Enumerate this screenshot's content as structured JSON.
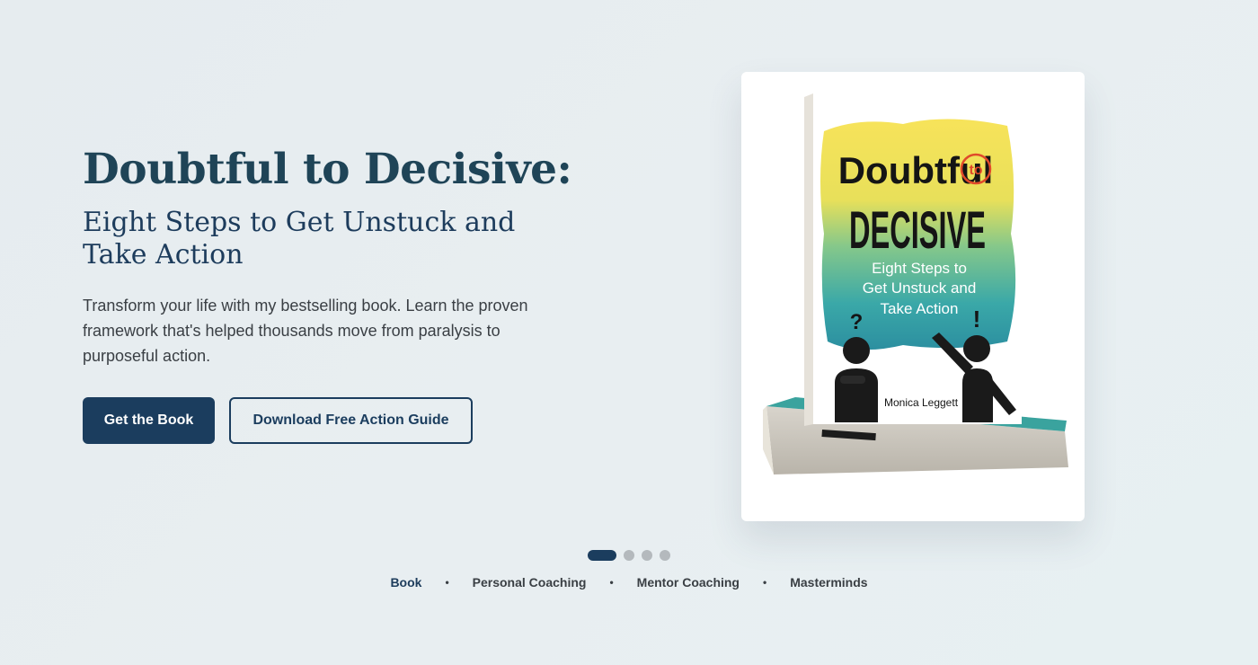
{
  "hero": {
    "title": "Doubtful to Decisive:",
    "subtitle": "Eight Steps to Get Unstuck and Take Action",
    "description": "Transform your life with my bestselling book. Learn the proven framework that's helped thousands move from paralysis to purposeful action.",
    "primary_button": "Get the Book",
    "secondary_button": "Download Free Action Guide"
  },
  "book_cover": {
    "title_line1": "Doubtful",
    "title_to": "to",
    "title_line2": "DECISIVE",
    "subtitle_line1": "Eight Steps to",
    "subtitle_line2": "Get Unstuck and",
    "subtitle_line3": "Take Action",
    "author": "Monica Leggett",
    "question_mark": "?",
    "exclamation_mark": "!"
  },
  "carousel": {
    "slide_count": 4,
    "active_index": 0
  },
  "slide_nav": {
    "items": [
      "Book",
      "Personal Coaching",
      "Mentor Coaching",
      "Masterminds"
    ],
    "separator": "•"
  },
  "colors": {
    "primary": "#1b3d5e",
    "title": "#1f4457",
    "accent_red": "#e04a2a"
  }
}
